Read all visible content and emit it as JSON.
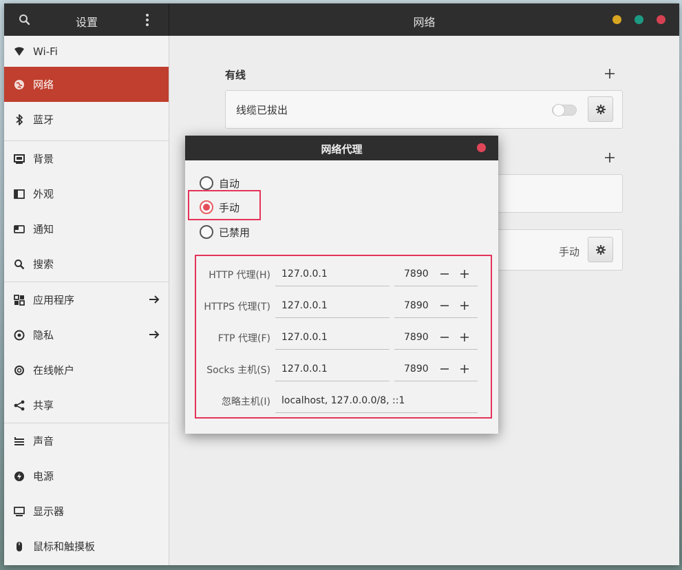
{
  "window": {
    "sidebar_title": "设置",
    "main_title": "网络"
  },
  "sidebar": {
    "items": [
      {
        "label": "Wi-Fi",
        "icon": "wifi-icon"
      },
      {
        "label": "网络",
        "icon": "network-icon",
        "active": true
      },
      {
        "label": "蓝牙",
        "icon": "bluetooth-icon"
      },
      {
        "label": "背景",
        "icon": "background-icon"
      },
      {
        "label": "外观",
        "icon": "appearance-icon"
      },
      {
        "label": "通知",
        "icon": "notification-icon"
      },
      {
        "label": "搜索",
        "icon": "search-icon"
      },
      {
        "label": "应用程序",
        "icon": "apps-icon",
        "arrow": true
      },
      {
        "label": "隐私",
        "icon": "privacy-icon",
        "arrow": true
      },
      {
        "label": "在线帐户",
        "icon": "online-accounts-icon"
      },
      {
        "label": "共享",
        "icon": "share-icon"
      },
      {
        "label": "声音",
        "icon": "sound-icon"
      },
      {
        "label": "电源",
        "icon": "power-icon"
      },
      {
        "label": "显示器",
        "icon": "display-icon"
      },
      {
        "label": "鼠标和触摸板",
        "icon": "mouse-icon"
      }
    ]
  },
  "main": {
    "wired_title": "有线",
    "wired_status": "线缆已拔出",
    "proxy_status": "手动"
  },
  "dialog": {
    "title": "网络代理",
    "options": [
      {
        "label": "自动",
        "checked": false
      },
      {
        "label": "手动",
        "checked": true
      },
      {
        "label": "已禁用",
        "checked": false
      }
    ],
    "proxies": [
      {
        "label": "HTTP 代理(H)",
        "host": "127.0.0.1",
        "port": "7890"
      },
      {
        "label": "HTTPS 代理(T)",
        "host": "127.0.0.1",
        "port": "7890"
      },
      {
        "label": "FTP 代理(F)",
        "host": "127.0.0.1",
        "port": "7890"
      },
      {
        "label": "Socks 主机(S)",
        "host": "127.0.0.1",
        "port": "7890"
      }
    ],
    "ignore_label": "忽略主机(I)",
    "ignore_value": "localhost, 127.0.0.0/8, ::1"
  },
  "colors": {
    "accent": "#c03f2e",
    "highlight": "#e43359",
    "titlebar": "#2e2e2e"
  }
}
